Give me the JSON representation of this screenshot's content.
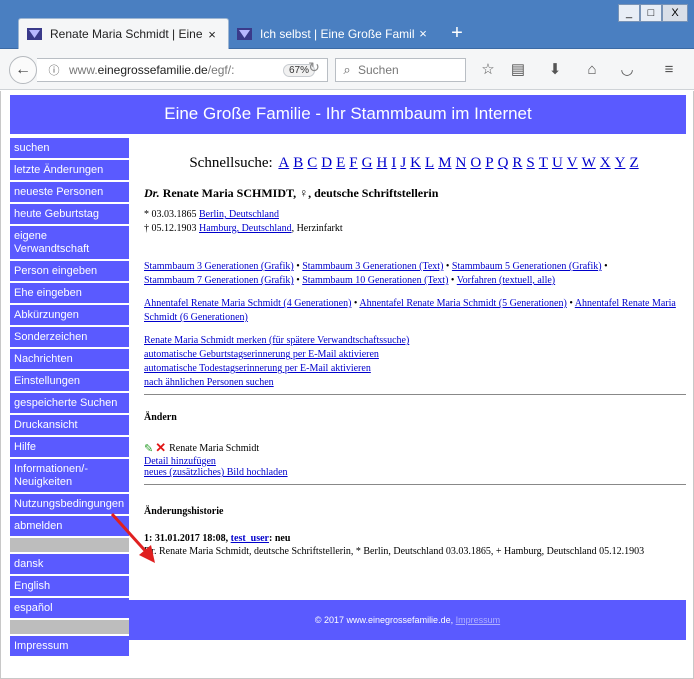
{
  "browser": {
    "tabs": [
      {
        "title": "Renate Maria Schmidt | Eine ...",
        "close": "×"
      },
      {
        "title": "Ich selbst | Eine Große Familie...",
        "close": "×"
      }
    ],
    "new_tab": "+",
    "url_gray": "www.",
    "url_domain": "einegrossefamilie.de",
    "url_rest": "/egf/:",
    "zoom": "67%",
    "search_placeholder": "Suchen",
    "window_min": "_",
    "window_max": "□",
    "window_close": "X"
  },
  "site": {
    "header": "Eine Große Familie - Ihr Stammbaum im Internet",
    "sidebar": [
      "suchen",
      "letzte Änderungen",
      "neueste Personen",
      "heute Geburtstag",
      "eigene Verwandtschaft",
      "Person eingeben",
      "Ehe eingeben",
      "Abkürzungen",
      "Sonderzeichen",
      "Nachrichten",
      "Einstellungen",
      "gespeicherte Suchen",
      "Druckansicht",
      "Hilfe",
      "Informationen/-Neuigkeiten",
      "Nutzungsbedingungen",
      "abmelden"
    ],
    "languages": [
      "dansk",
      "English",
      "español"
    ],
    "impressum_side": "Impressum"
  },
  "quicksearch": {
    "label": "Schnellsuche:",
    "letters": [
      "A",
      "B",
      "C",
      "D",
      "E",
      "F",
      "G",
      "H",
      "I",
      "J",
      "K",
      "L",
      "M",
      "N",
      "O",
      "P",
      "Q",
      "R",
      "S",
      "T",
      "U",
      "V",
      "W",
      "X",
      "Y",
      "Z"
    ]
  },
  "person": {
    "title_prefix": "Dr.",
    "name": "Renate Maria SCHMIDT",
    "sex_symbol": "♀",
    "occupation": ", deutsche Schriftstellerin",
    "birth_prefix": "* 03.03.1865",
    "birth_place": "Berlin, Deutschland",
    "death_prefix": "† 05.12.1903",
    "death_place": "Hamburg, Deutschland",
    "death_cause": ", Herzinfarkt"
  },
  "links": {
    "stammbaum": [
      "Stammbaum 3 Generationen (Grafik)",
      "Stammbaum 3 Generationen (Text)",
      "Stammbaum 5 Generationen (Grafik)",
      "Stammbaum 7 Generationen (Grafik)",
      "Stammbaum 10 Generationen (Text)",
      "Vorfahren (textuell, alle)"
    ],
    "ahnentafel": [
      "Ahnentafel Renate Maria Schmidt (4 Generationen)",
      "Ahnentafel Renate Maria Schmidt (5 Generationen)",
      "Ahnentafel Renate Maria Schmidt (6 Generationen)"
    ],
    "actions": [
      "Renate Maria Schmidt merken (für spätere Verwandtschaftssuche)",
      "automatische Geburtstagserinnerung per E-Mail aktivieren",
      "automatische Todestagserinnerung per E-Mail aktivieren",
      "nach ähnlichen Personen suchen"
    ],
    "separator": "•"
  },
  "edit": {
    "heading": "Ändern",
    "person_name": "Renate Maria Schmidt",
    "add_detail": "Detail hinzufügen",
    "upload_image": "neues (zusätzliches) Bild hochladen"
  },
  "history": {
    "heading": "Änderungshistorie",
    "entry_prefix": "1: 31.01.2017 18:08,",
    "entry_user": "test_user",
    "entry_suffix": ": neu",
    "entry_text": "Dr. Renate Maria Schmidt, deutsche Schriftstellerin, * Berlin, Deutschland 03.03.1865, + Hamburg, Deutschland 05.12.1903"
  },
  "footer": {
    "copyright": "© 2017 www.einegrossefamilie.de,",
    "impressum": "Impressum"
  },
  "colors": {
    "site_blue": "#5a5aff",
    "titlebar": "#4a7fc1",
    "link": "#0000cc",
    "annotation_arrow": "#e02020"
  }
}
